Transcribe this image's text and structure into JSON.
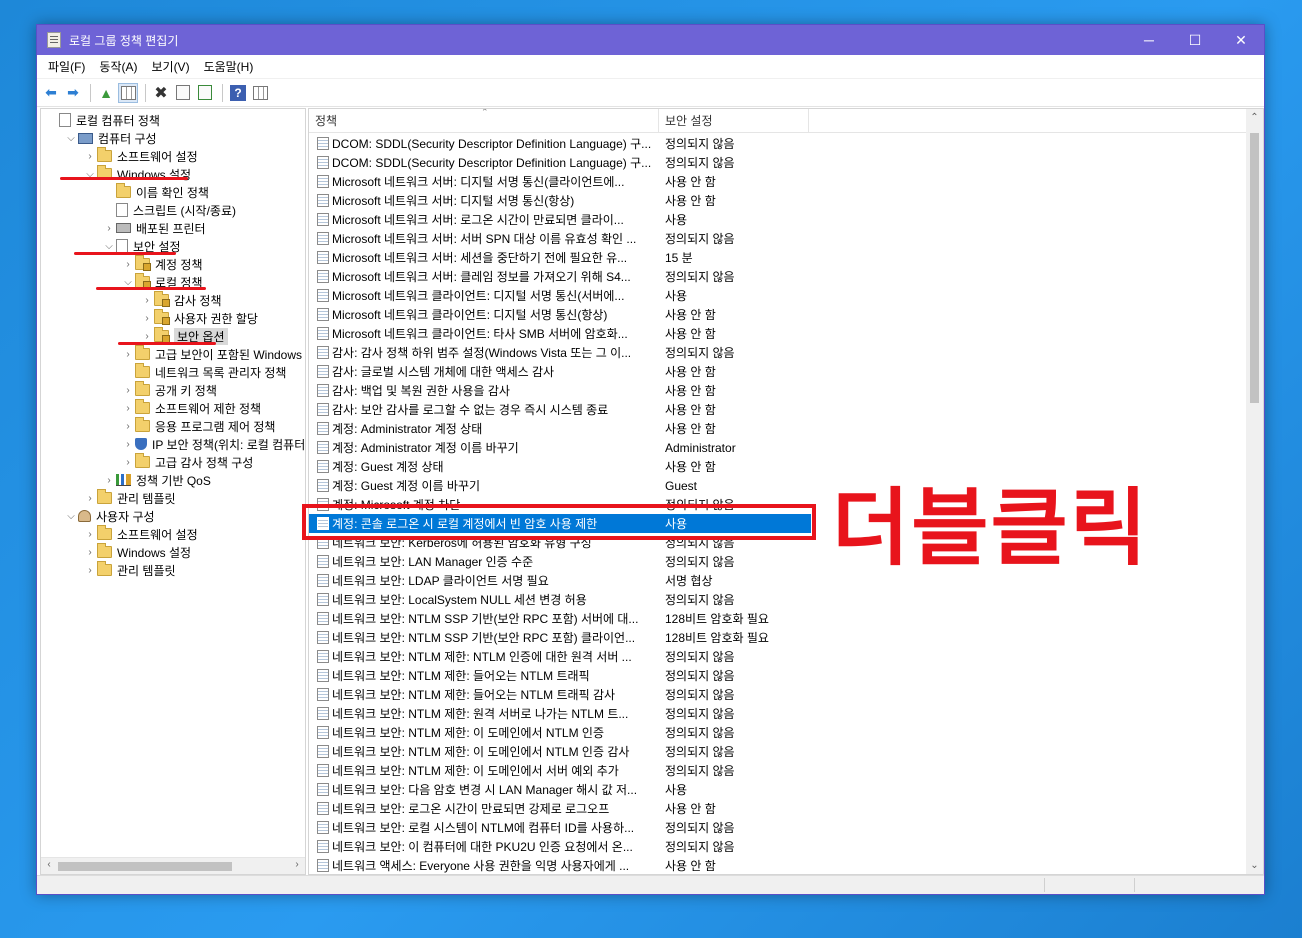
{
  "window": {
    "title": "로컬 그룹 정책 편집기",
    "caption": {
      "minimize": "─",
      "maximize": "☐",
      "close": "✕"
    }
  },
  "menu": [
    "파일(F)",
    "동작(A)",
    "보기(V)",
    "도움말(H)"
  ],
  "toolbar": {
    "icons": [
      "back-arrow-icon",
      "forward-arrow-icon",
      "up-folder-icon",
      "show-hide-tree-icon",
      "delete-icon",
      "properties-icon",
      "export-list-icon",
      "help-icon",
      "view-grid-icon"
    ]
  },
  "tree": {
    "items": [
      {
        "label": "로컬 컴퓨터 정책",
        "icon": "doc",
        "expander": ""
      },
      {
        "label": "컴퓨터 구성",
        "icon": "pc",
        "expander": "⌵"
      },
      {
        "label": "소프트웨어 설정",
        "icon": "folder",
        "expander": "›"
      },
      {
        "label": "Windows 설정",
        "icon": "folder",
        "expander": "⌵"
      },
      {
        "label": "이름 확인 정책",
        "icon": "folder",
        "expander": ""
      },
      {
        "label": "스크립트 (시작/종료)",
        "icon": "doc",
        "expander": ""
      },
      {
        "label": "배포된 프린터",
        "icon": "printer",
        "expander": "›"
      },
      {
        "label": "보안 설정",
        "icon": "doc",
        "expander": "⌵"
      },
      {
        "label": "계정 정책",
        "icon": "folder-lock",
        "expander": "›"
      },
      {
        "label": "로컬 정책",
        "icon": "folder-lock",
        "expander": "⌵"
      },
      {
        "label": "감사 정책",
        "icon": "folder-lock",
        "expander": "›"
      },
      {
        "label": "사용자 권한 할당",
        "icon": "folder-lock",
        "expander": "›"
      },
      {
        "label": "보안 옵션",
        "icon": "folder-lock",
        "expander": "›"
      },
      {
        "label": "고급 보안이 포함된 Windows D",
        "icon": "folder",
        "expander": "›"
      },
      {
        "label": "네트워크 목록 관리자 정책",
        "icon": "folder",
        "expander": ""
      },
      {
        "label": "공개 키 정책",
        "icon": "folder",
        "expander": "›"
      },
      {
        "label": "소프트웨어 제한 정책",
        "icon": "folder",
        "expander": "›"
      },
      {
        "label": "응용 프로그램 제어 정책",
        "icon": "folder",
        "expander": "›"
      },
      {
        "label": "IP 보안 정책(위치: 로컬 컴퓨터",
        "icon": "shield",
        "expander": "›"
      },
      {
        "label": "고급 감사 정책 구성",
        "icon": "folder",
        "expander": "›"
      },
      {
        "label": "정책 기반 QoS",
        "icon": "chart",
        "expander": "›"
      },
      {
        "label": "관리 템플릿",
        "icon": "folder",
        "expander": "›"
      },
      {
        "label": "사용자 구성",
        "icon": "user",
        "expander": "⌵"
      },
      {
        "label": "소프트웨어 설정",
        "icon": "folder",
        "expander": "›"
      },
      {
        "label": "Windows 설정",
        "icon": "folder",
        "expander": "›"
      },
      {
        "label": "관리 템플릿",
        "icon": "folder",
        "expander": "›"
      }
    ],
    "scroll_left": "‹",
    "scroll_right": "›"
  },
  "list": {
    "headers": {
      "policy": "정책",
      "setting": "보안 설정",
      "sort": "⌃"
    },
    "rows": [
      {
        "policy": "DCOM: SDDL(Security Descriptor Definition Language) 구...",
        "setting": "정의되지 않음"
      },
      {
        "policy": "DCOM: SDDL(Security Descriptor Definition Language) 구...",
        "setting": "정의되지 않음"
      },
      {
        "policy": "Microsoft 네트워크 서버: 디지털 서명 통신(클라이언트에...",
        "setting": "사용 안 함"
      },
      {
        "policy": "Microsoft 네트워크 서버: 디지털 서명 통신(항상)",
        "setting": "사용 안 함"
      },
      {
        "policy": "Microsoft 네트워크 서버: 로그온 시간이 만료되면 클라이...",
        "setting": "사용"
      },
      {
        "policy": "Microsoft 네트워크 서버: 서버 SPN 대상 이름 유효성 확인 ...",
        "setting": "정의되지 않음"
      },
      {
        "policy": "Microsoft 네트워크 서버: 세션을 중단하기 전에 필요한 유...",
        "setting": "15 분"
      },
      {
        "policy": "Microsoft 네트워크 서버: 클레임 정보를 가져오기 위해 S4...",
        "setting": "정의되지 않음"
      },
      {
        "policy": "Microsoft 네트워크 클라이언트: 디지털 서명 통신(서버에...",
        "setting": "사용"
      },
      {
        "policy": "Microsoft 네트워크 클라이언트: 디지털 서명 통신(항상)",
        "setting": "사용 안 함"
      },
      {
        "policy": "Microsoft 네트워크 클라이언트: 타사 SMB 서버에 암호화...",
        "setting": "사용 안 함"
      },
      {
        "policy": "감사: 감사 정책 하위 범주 설정(Windows Vista 또는 그 이...",
        "setting": "정의되지 않음"
      },
      {
        "policy": "감사: 글로벌 시스템 개체에 대한 액세스 감사",
        "setting": "사용 안 함"
      },
      {
        "policy": "감사: 백업 및 복원 권한 사용을 감사",
        "setting": "사용 안 함"
      },
      {
        "policy": "감사: 보안 감사를 로그할 수 없는 경우 즉시 시스템 종료",
        "setting": "사용 안 함"
      },
      {
        "policy": "계정: Administrator 계정 상태",
        "setting": "사용 안 함"
      },
      {
        "policy": "계정: Administrator 계정 이름 바꾸기",
        "setting": "Administrator"
      },
      {
        "policy": "계정: Guest 계정 상태",
        "setting": "사용 안 함"
      },
      {
        "policy": "계정: Guest 계정 이름 바꾸기",
        "setting": "Guest"
      },
      {
        "policy": "계정: Microsoft 계정 차단",
        "setting": "정의되지 않음"
      },
      {
        "policy": "계정: 콘솔 로그온 시 로컬 계정에서 빈 암호 사용 제한",
        "setting": "사용"
      },
      {
        "policy": "네트워크 보안: Kerberos에 허용된 암호화 유형 구성",
        "setting": "정의되지 않음"
      },
      {
        "policy": "네트워크 보안: LAN Manager 인증 수준",
        "setting": "정의되지 않음"
      },
      {
        "policy": "네트워크 보안: LDAP 클라이언트 서명 필요",
        "setting": "서명 협상"
      },
      {
        "policy": "네트워크 보안: LocalSystem NULL 세션 변경 허용",
        "setting": "정의되지 않음"
      },
      {
        "policy": "네트워크 보안: NTLM SSP 기반(보안 RPC 포함) 서버에 대...",
        "setting": "128비트 암호화 필요"
      },
      {
        "policy": "네트워크 보안: NTLM SSP 기반(보안 RPC 포함) 클라이언...",
        "setting": "128비트 암호화 필요"
      },
      {
        "policy": "네트워크 보안: NTLM 제한: NTLM 인증에 대한 원격 서버 ...",
        "setting": "정의되지 않음"
      },
      {
        "policy": "네트워크 보안: NTLM 제한: 들어오는 NTLM 트래픽",
        "setting": "정의되지 않음"
      },
      {
        "policy": "네트워크 보안: NTLM 제한: 들어오는 NTLM 트래픽 감사",
        "setting": "정의되지 않음"
      },
      {
        "policy": "네트워크 보안: NTLM 제한: 원격 서버로 나가는 NTLM 트...",
        "setting": "정의되지 않음"
      },
      {
        "policy": "네트워크 보안: NTLM 제한: 이 도메인에서 NTLM 인증",
        "setting": "정의되지 않음"
      },
      {
        "policy": "네트워크 보안: NTLM 제한: 이 도메인에서 NTLM 인증 감사",
        "setting": "정의되지 않음"
      },
      {
        "policy": "네트워크 보안: NTLM 제한: 이 도메인에서 서버 예외 추가",
        "setting": "정의되지 않음"
      },
      {
        "policy": "네트워크 보안: 다음 암호 변경 시 LAN Manager 해시 값 저...",
        "setting": "사용"
      },
      {
        "policy": "네트워크 보안: 로그온 시간이 만료되면 강제로 로그오프",
        "setting": "사용 안 함"
      },
      {
        "policy": "네트워크 보안: 로컬 시스템이 NTLM에 컴퓨터 ID를 사용하...",
        "setting": "정의되지 않음"
      },
      {
        "policy": "네트워크 보안: 이 컴퓨터에 대한 PKU2U 인증 요청에서 온...",
        "setting": "정의되지 않음"
      },
      {
        "policy": "네트워크 액세스: Everyone 사용 권한을 익명 사용자에게 ...",
        "setting": "사용 안 함"
      }
    ],
    "scroll_up": "⌃",
    "scroll_down": "⌄"
  },
  "annotation": {
    "text": "더블클릭",
    "color": "#e8141c"
  }
}
